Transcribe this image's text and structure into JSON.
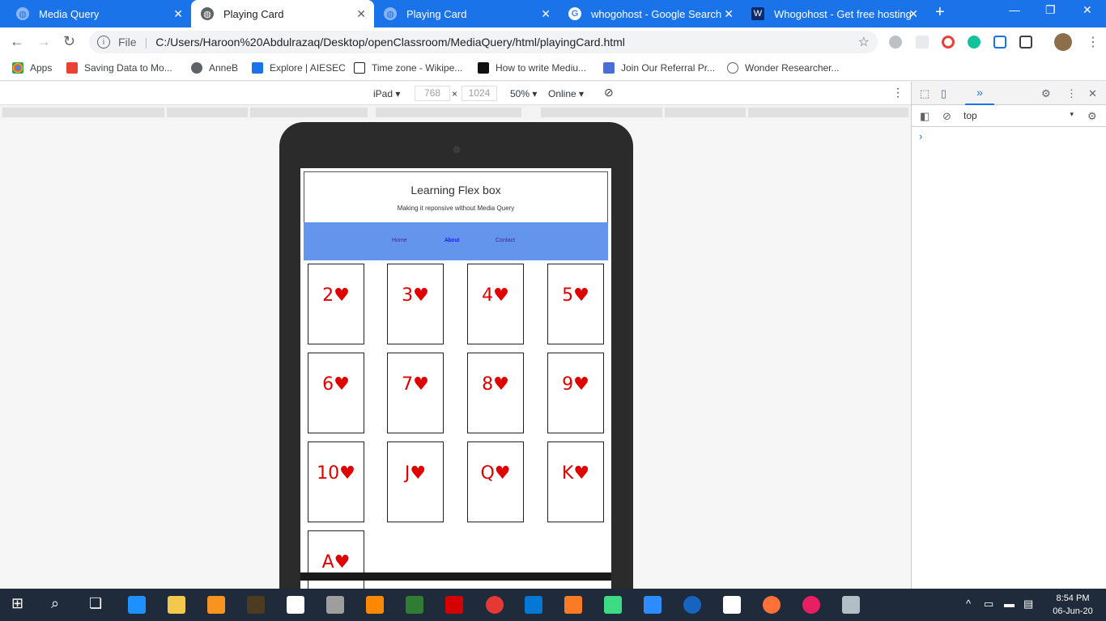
{
  "tabs": [
    {
      "title": "Media Query",
      "icon": "globe-icon",
      "active": false
    },
    {
      "title": "Playing Card",
      "icon": "globe-icon",
      "active": true
    },
    {
      "title": "Playing Card",
      "icon": "globe-icon",
      "active": false
    },
    {
      "title": "whogohost - Google Search",
      "icon": "google-icon",
      "active": false
    },
    {
      "title": "Whogohost - Get free hosting",
      "icon": "whogohost-icon",
      "active": false
    }
  ],
  "toolbar": {
    "scheme": "File",
    "url": "C:/Users/Haroon%20Abdulrazaq/Desktop/openClassroom/MediaQuery/html/playingCard.html"
  },
  "bookmarks": [
    {
      "label": "Apps",
      "color": "#4285f4"
    },
    {
      "label": "Saving Data to Mo...",
      "color": "#e94235"
    },
    {
      "label": "AnneB",
      "color": "#5f6368"
    },
    {
      "label": "Explore | AIESEC",
      "color": "#1a73e8"
    },
    {
      "label": "Time zone - Wikipe...",
      "color": "#202124"
    },
    {
      "label": "How to write Mediu...",
      "color": "#111111"
    },
    {
      "label": "Join Our Referral Pr...",
      "color": "#4a6ed8"
    },
    {
      "label": "Wonder Researcher...",
      "color": "#5f6368"
    }
  ],
  "device_toolbar": {
    "device": "iPad",
    "width": "768",
    "times": "×",
    "height": "1024",
    "zoom": "50%",
    "network": "Online"
  },
  "page": {
    "title": "Learning Flex box",
    "subtitle": "Making it reponsive without Media Query",
    "nav": [
      {
        "label": "Home",
        "color": "#551a8b"
      },
      {
        "label": "About",
        "color": "#0000ee"
      },
      {
        "label": "Contact",
        "color": "#551a8b"
      }
    ],
    "cards": [
      "2♥",
      "3♥",
      "4♥",
      "5♥",
      "6♥",
      "7♥",
      "8♥",
      "9♥",
      "10♥",
      "J♥",
      "Q♥",
      "K♥",
      "A♥"
    ],
    "card_color": "#e00000",
    "nav_bg": "#6495ed"
  },
  "devtools": {
    "context": "top",
    "prompt": "›"
  },
  "taskbar": {
    "time": "8:54 PM",
    "date": "06-Jun-20"
  }
}
